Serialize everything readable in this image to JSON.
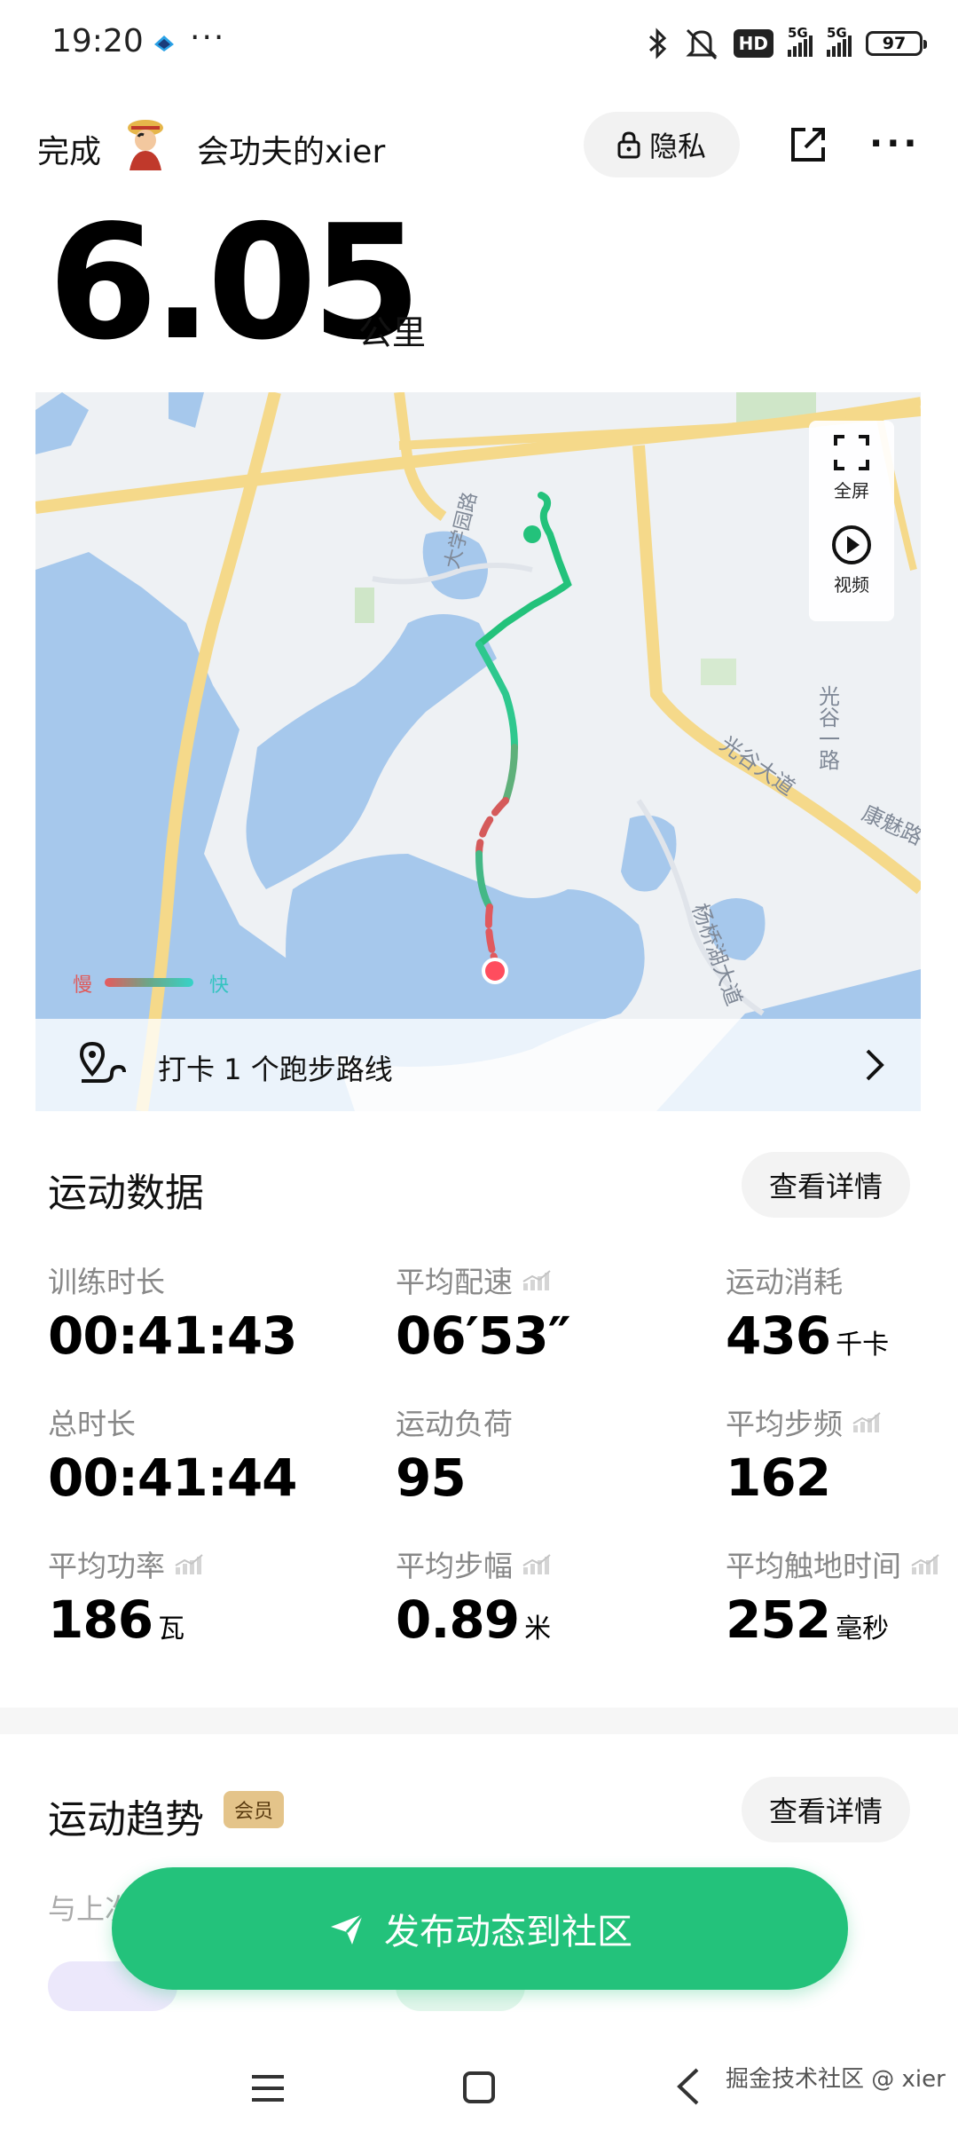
{
  "status_bar": {
    "time": "19:20",
    "more": "···",
    "hd_label": "HD",
    "network_1": "5G",
    "network_2": "5G",
    "battery": "97"
  },
  "header": {
    "done_label": "完成",
    "username": "会功夫的xier",
    "privacy_label": "隐私"
  },
  "distance": {
    "value": "6.05",
    "unit": "公里"
  },
  "map": {
    "tools": {
      "fullscreen_label": "全屏",
      "video_label": "视频"
    },
    "legend": {
      "slow": "慢",
      "fast": "快"
    },
    "place_labels": [
      "大学园路",
      "光谷一路",
      "光谷大道",
      "康魅路",
      "杨桥湖大道"
    ],
    "checkin_label": "打卡 1 个跑步路线"
  },
  "exercise_data": {
    "title": "运动数据",
    "detail_button": "查看详情",
    "metrics": [
      {
        "label": "训练时长",
        "value": "00:41:43",
        "unit": "",
        "trend": false
      },
      {
        "label": "平均配速",
        "value": "06′53″",
        "unit": "",
        "trend": true
      },
      {
        "label": "运动消耗",
        "value": "436",
        "unit": "千卡",
        "trend": false
      },
      {
        "label": "总时长",
        "value": "00:41:44",
        "unit": "",
        "trend": false
      },
      {
        "label": "运动负荷",
        "value": "95",
        "unit": "",
        "trend": false
      },
      {
        "label": "平均步频",
        "value": "162",
        "unit": "",
        "trend": true
      },
      {
        "label": "平均功率",
        "value": "186",
        "unit": "瓦",
        "trend": true
      },
      {
        "label": "平均步幅",
        "value": "0.89",
        "unit": "米",
        "trend": true
      },
      {
        "label": "平均触地时间",
        "value": "252",
        "unit": "毫秒",
        "trend": true
      }
    ]
  },
  "trend": {
    "title": "运动趋势",
    "vip_badge": "会员",
    "detail_button": "查看详情",
    "compare_label": "与上次"
  },
  "publish_button": "发布动态到社区",
  "watermark": "掘金技术社区 @ xier",
  "colors": {
    "accent": "#23c27b",
    "route_slow": "#e75a5e",
    "route_fast": "#36d3c8",
    "water": "#a6c8ec",
    "road": "#f5d98a"
  }
}
